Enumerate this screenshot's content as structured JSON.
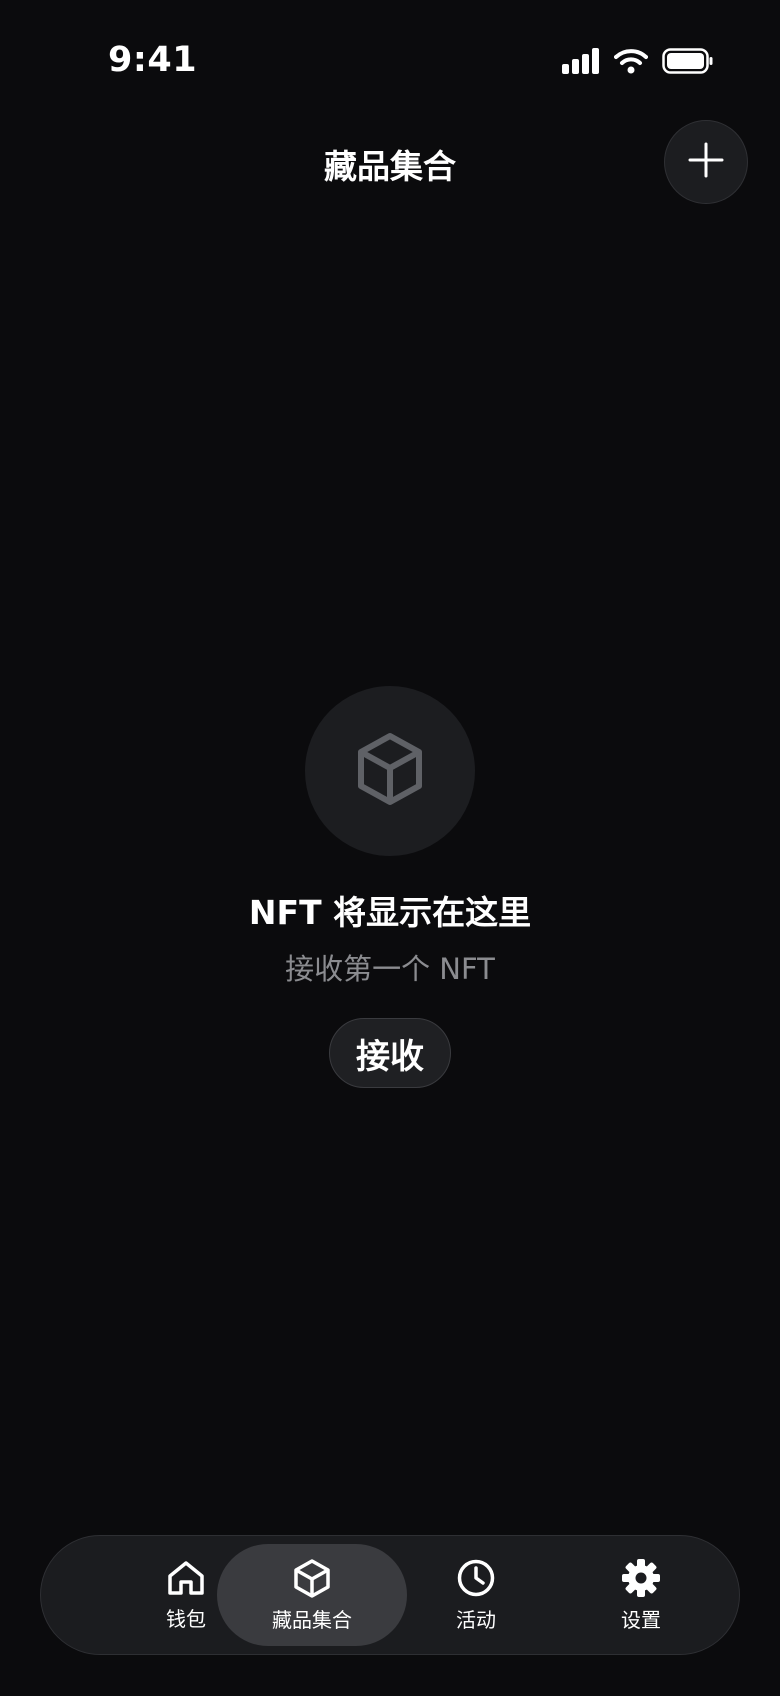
{
  "status_bar": {
    "time": "9:41",
    "icons": [
      "signal-icon",
      "wifi-icon",
      "battery-icon"
    ]
  },
  "header": {
    "title": "藏品集合",
    "add_icon": "plus-icon"
  },
  "empty_state": {
    "icon": "cube-icon",
    "title": "NFT 将显示在这里",
    "subtitle": "接收第一个 NFT",
    "button_label": "接收"
  },
  "tab_bar": {
    "tabs": [
      {
        "label": "钱包",
        "icon": "home-icon",
        "active": false
      },
      {
        "label": "藏品集合",
        "icon": "cube-icon",
        "active": true
      },
      {
        "label": "活动",
        "icon": "clock-icon",
        "active": false
      },
      {
        "label": "设置",
        "icon": "gear-icon",
        "active": false
      }
    ]
  },
  "colors": {
    "background": "#0b0b0d",
    "surface": "#1c1d20",
    "active_tab": "#3a3b3f",
    "muted_text": "#8b8c90",
    "empty_icon": "#5f6166"
  }
}
